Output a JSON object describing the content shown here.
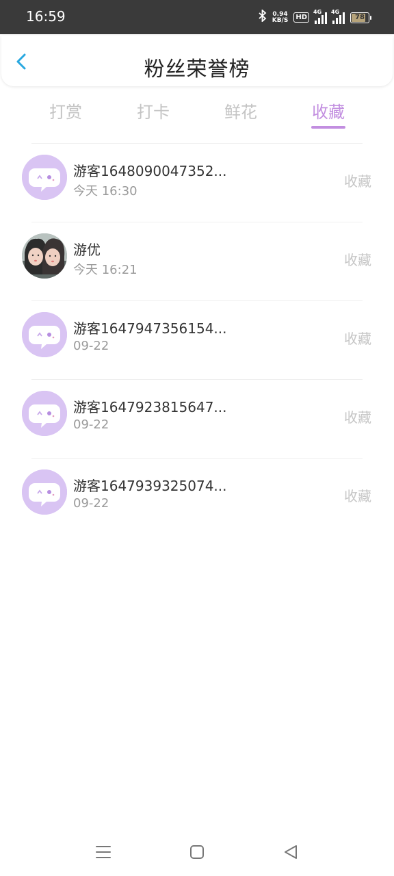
{
  "status_bar": {
    "time": "16:59",
    "speed_value": "0.94",
    "speed_unit": "KB/S",
    "hd": "HD",
    "network1": "4G",
    "network2": "4G",
    "battery": "78",
    "battery_level": 0.78
  },
  "header": {
    "title": "粉丝荣誉榜",
    "back_icon": "chevron-left-icon",
    "accent_color": "#29a8e0"
  },
  "tabs": [
    {
      "label": "打赏",
      "active": false
    },
    {
      "label": "打卡",
      "active": false
    },
    {
      "label": "鲜花",
      "active": false
    },
    {
      "label": "收藏",
      "active": true
    }
  ],
  "active_color": "#c28ee0",
  "list": [
    {
      "name": "游客1648090047352...",
      "time": "今天 16:30",
      "action": "收藏",
      "avatar": "default-avatar"
    },
    {
      "name": "游优",
      "time": "今天 16:21",
      "action": "收藏",
      "avatar": "photo-avatar"
    },
    {
      "name": "游客1647947356154...",
      "time": "09-22",
      "action": "收藏",
      "avatar": "default-avatar"
    },
    {
      "name": "游客1647923815647...",
      "time": "09-22",
      "action": "收藏",
      "avatar": "default-avatar"
    },
    {
      "name": "游客1647939325074...",
      "time": "09-22",
      "action": "收藏",
      "avatar": "default-avatar"
    }
  ],
  "nav": {
    "menu_icon": "menu-icon",
    "home_icon": "home-square-icon",
    "back_icon": "back-triangle-icon"
  }
}
